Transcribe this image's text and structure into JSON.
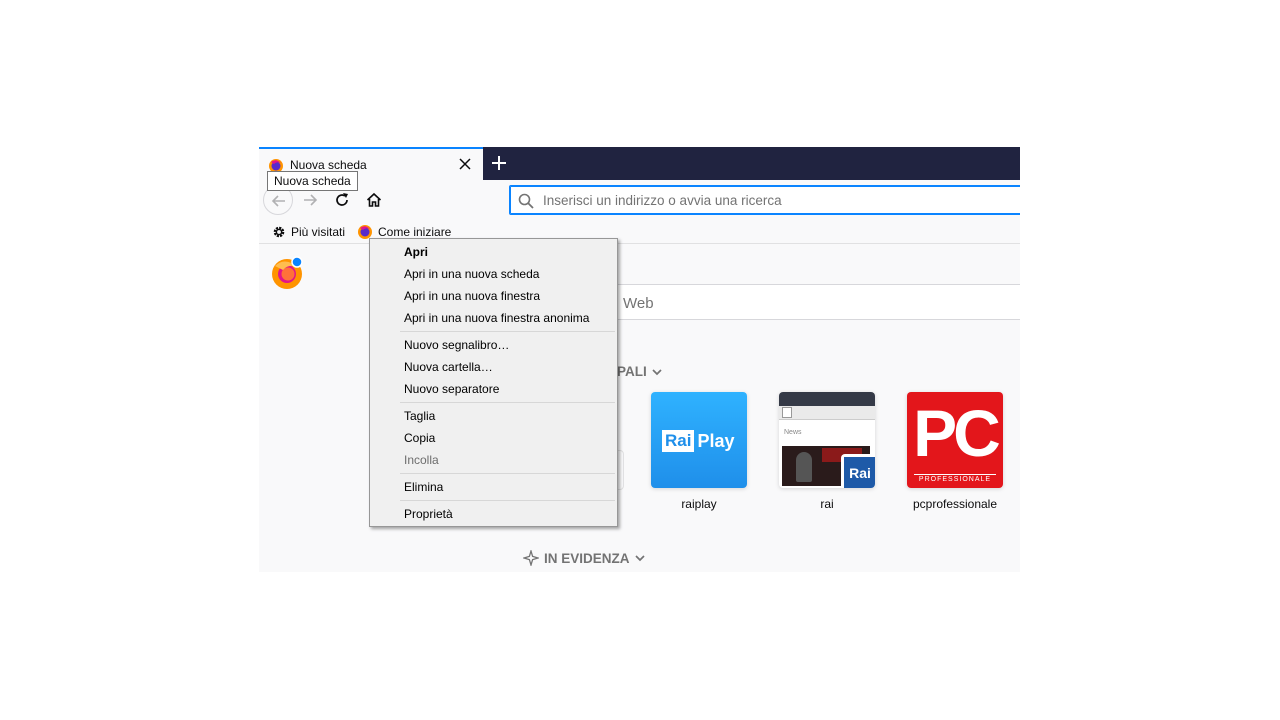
{
  "tab": {
    "title": "Nuova scheda",
    "tooltip": "Nuova scheda"
  },
  "urlbar": {
    "placeholder": "Inserisci un indirizzo o avvia una ricerca",
    "value": ""
  },
  "bookmarks": [
    {
      "label": "Più visitati",
      "icon": "gear-icon"
    },
    {
      "label": "Come iniziare",
      "icon": "firefox-icon"
    }
  ],
  "newtab": {
    "search_placeholder": "Web",
    "top_sites_heading": "PALI",
    "highlights_heading": "IN EVIDENZA",
    "tiles": [
      {
        "label": "raiplay",
        "logo_text_1": "Rai",
        "logo_text_2": "Play",
        "color": "#2d9bf0"
      },
      {
        "label": "rai",
        "logo_text": "Rai",
        "preview_text": "News"
      },
      {
        "label": "pcprofessionale",
        "logo_text": "PC",
        "logo_subtext": "PROFESSIONALE",
        "color": "#e3161b"
      }
    ]
  },
  "context_menu": {
    "items": [
      {
        "label": "Apri",
        "bold": true,
        "disabled": false,
        "separator_after": false
      },
      {
        "label": "Apri in una nuova scheda",
        "bold": false,
        "disabled": false,
        "separator_after": false
      },
      {
        "label": "Apri in una nuova finestra",
        "bold": false,
        "disabled": false,
        "separator_after": false
      },
      {
        "label": "Apri in una nuova finestra anonima",
        "bold": false,
        "disabled": false,
        "separator_after": true
      },
      {
        "label": "Nuovo segnalibro…",
        "bold": false,
        "disabled": false,
        "separator_after": false
      },
      {
        "label": "Nuova cartella…",
        "bold": false,
        "disabled": false,
        "separator_after": false
      },
      {
        "label": "Nuovo separatore",
        "bold": false,
        "disabled": false,
        "separator_after": true
      },
      {
        "label": "Taglia",
        "bold": false,
        "disabled": false,
        "separator_after": false
      },
      {
        "label": "Copia",
        "bold": false,
        "disabled": false,
        "separator_after": false
      },
      {
        "label": "Incolla",
        "bold": false,
        "disabled": true,
        "separator_after": true
      },
      {
        "label": "Elimina",
        "bold": false,
        "disabled": false,
        "separator_after": true
      },
      {
        "label": "Proprietà",
        "bold": false,
        "disabled": false,
        "separator_after": false
      }
    ]
  },
  "colors": {
    "accent": "#0a84ff",
    "tabbar": "#202340",
    "menu_bg": "#f0f0f0"
  }
}
